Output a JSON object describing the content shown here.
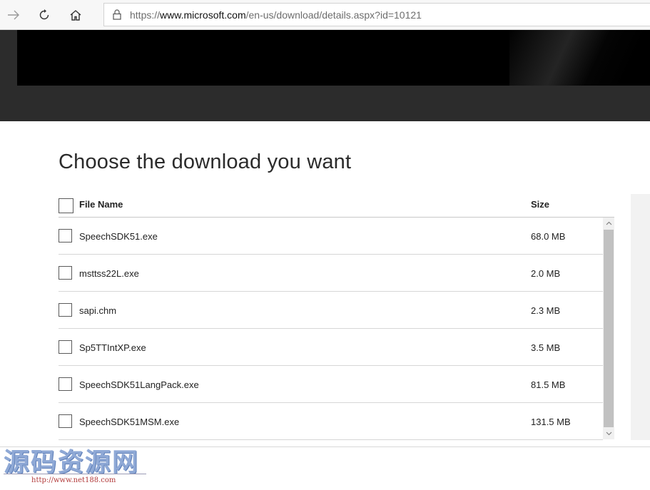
{
  "browser": {
    "url_scheme": "https://",
    "url_host": "www.microsoft.com",
    "url_path": "/en-us/download/details.aspx?id=10121",
    "icons": [
      "forward-arrow-icon",
      "refresh-icon",
      "home-icon",
      "lock-icon"
    ]
  },
  "page": {
    "heading": "Choose the download you want",
    "columns": {
      "name": "File Name",
      "size": "Size"
    },
    "files": [
      {
        "name": "SpeechSDK51.exe",
        "size": "68.0 MB"
      },
      {
        "name": "msttss22L.exe",
        "size": "2.0 MB"
      },
      {
        "name": "sapi.chm",
        "size": "2.3 MB"
      },
      {
        "name": "Sp5TTIntXP.exe",
        "size": "3.5 MB"
      },
      {
        "name": "SpeechSDK51LangPack.exe",
        "size": "81.5 MB"
      },
      {
        "name": "SpeechSDK51MSM.exe",
        "size": "131.5 MB"
      }
    ]
  },
  "watermark": {
    "title": "源码资源网",
    "url": "http://www.net188.com"
  }
}
